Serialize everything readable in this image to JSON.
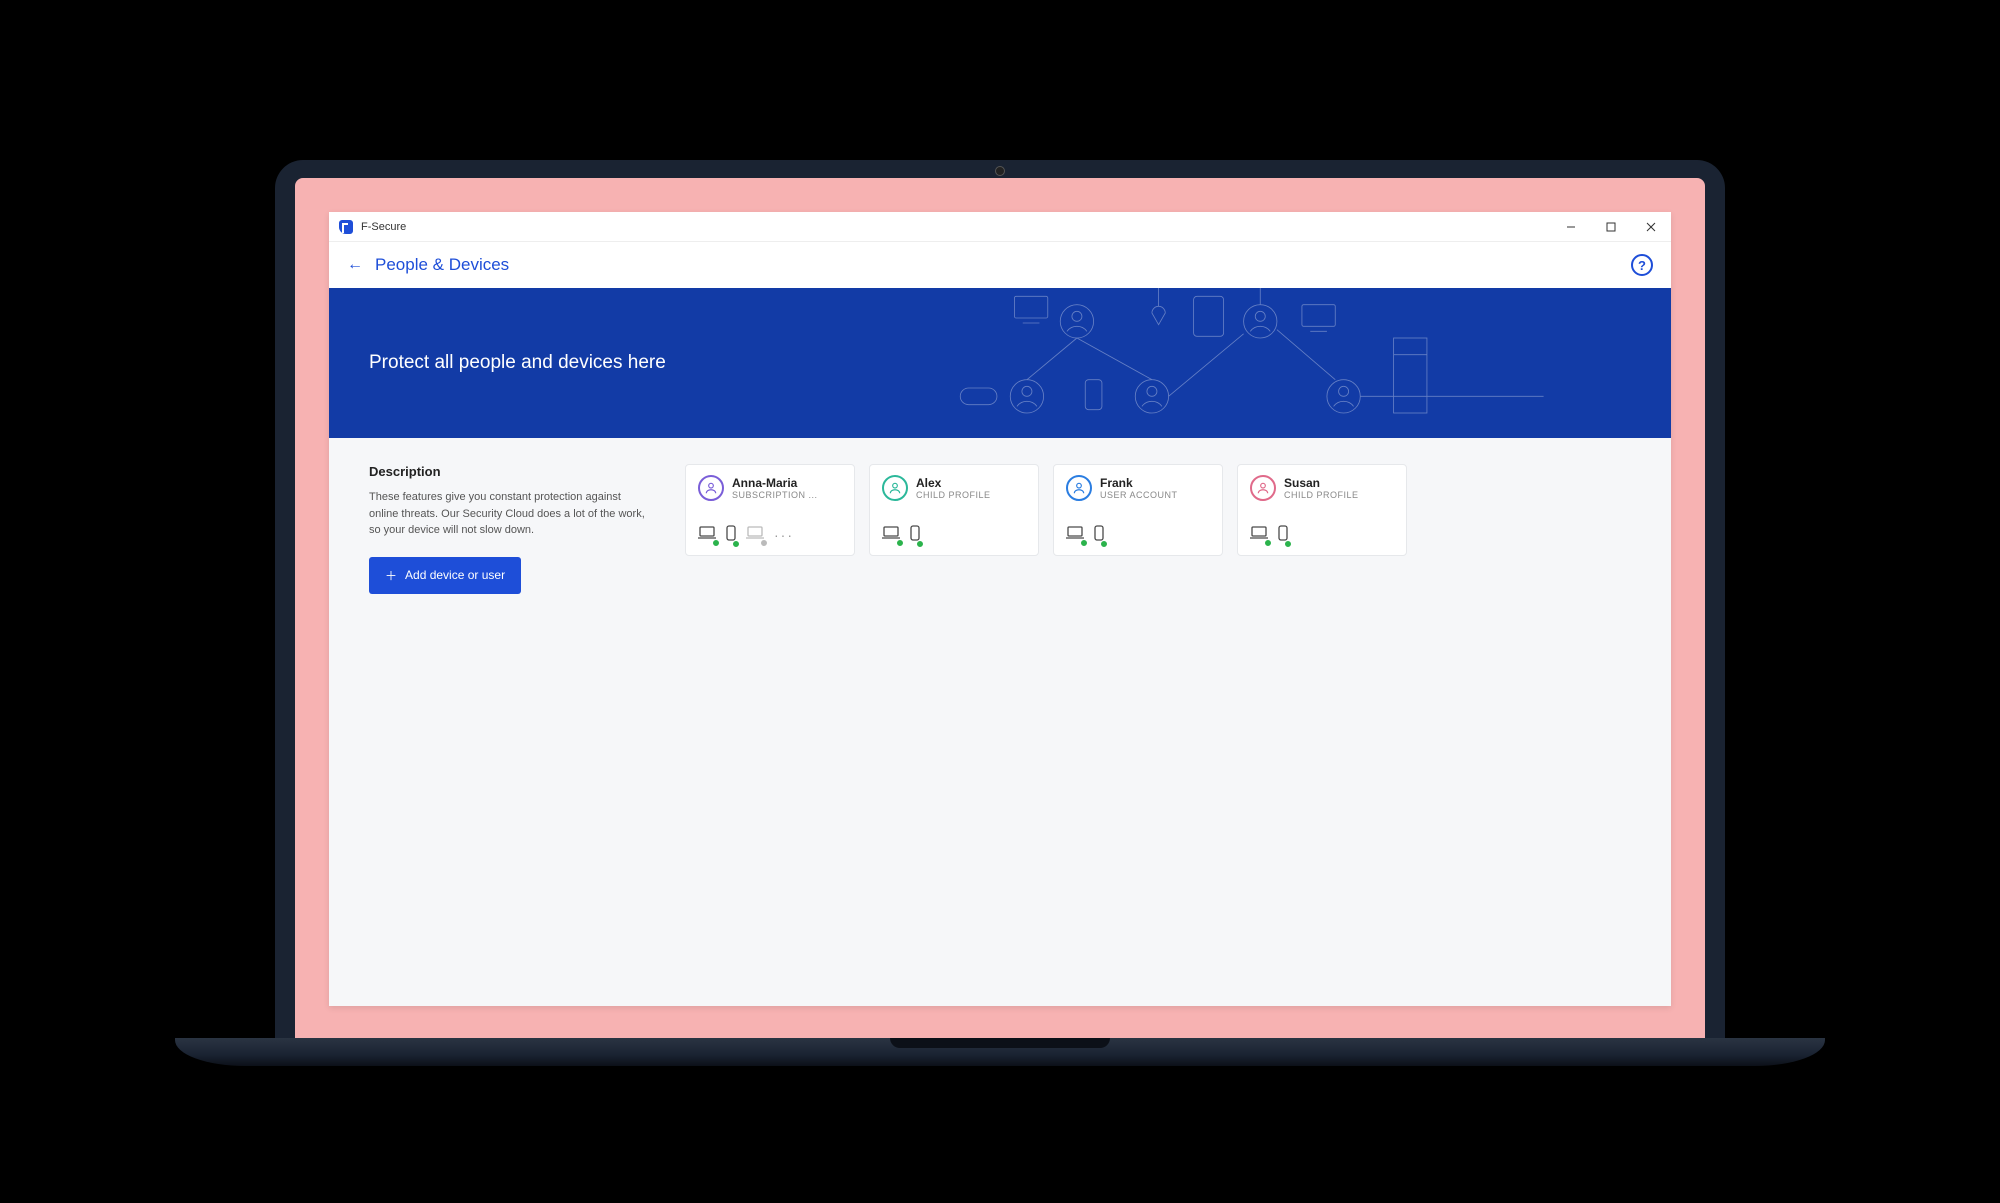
{
  "app": {
    "name": "F-Secure"
  },
  "header": {
    "page_title": "People & Devices",
    "help_glyph": "?"
  },
  "banner": {
    "title": "Protect all people and devices here"
  },
  "description": {
    "heading": "Description",
    "body": "These features give you constant protection against online threats. Our Security Cloud does a lot of the work, so your device will not slow down.",
    "add_button_label": "Add device or user"
  },
  "people": [
    {
      "name": "Anna-Maria",
      "role": "SUBSCRIPTION ...",
      "accent": "purple",
      "devices": [
        "laptop-ok",
        "phone-ok",
        "laptop-gray"
      ],
      "more": true
    },
    {
      "name": "Alex",
      "role": "CHILD PROFILE",
      "accent": "teal",
      "devices": [
        "laptop-ok",
        "phone-ok"
      ],
      "more": false
    },
    {
      "name": "Frank",
      "role": "USER ACCOUNT",
      "accent": "blue",
      "devices": [
        "laptop-ok",
        "phone-ok"
      ],
      "more": false
    },
    {
      "name": "Susan",
      "role": "CHILD PROFILE",
      "accent": "pink",
      "devices": [
        "laptop-ok",
        "phone-ok"
      ],
      "more": false
    }
  ]
}
